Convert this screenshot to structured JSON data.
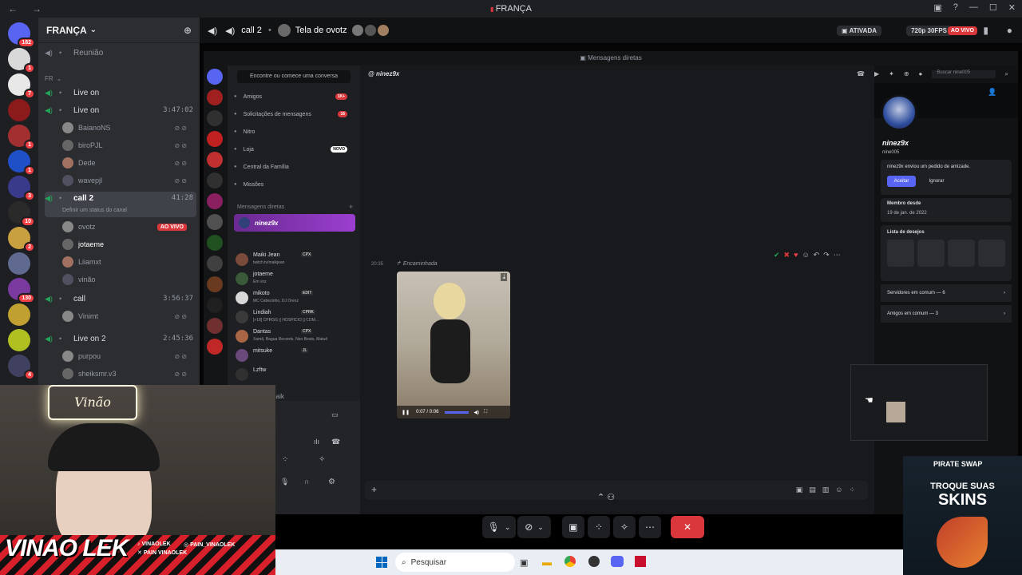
{
  "window": {
    "title": "FRANÇA",
    "nav_back": "←",
    "nav_fwd": "→"
  },
  "guild": {
    "name": "FRANÇA",
    "chevron": "⌄"
  },
  "servers": [
    {
      "badge": "182",
      "color": "#5865f2"
    },
    {
      "badge": "1",
      "color": "#d9d9d9"
    },
    {
      "badge": "7",
      "color": "#e8e8e8"
    },
    {
      "badge": "",
      "color": "#8b1a1a"
    },
    {
      "badge": "1",
      "color": "#a23030"
    },
    {
      "badge": "1",
      "color": "#2050c8"
    },
    {
      "badge": "3",
      "color": "#3a3a8a"
    },
    {
      "badge": "10",
      "color": "#2a2a2a"
    },
    {
      "badge": "2",
      "color": "#c8a040"
    },
    {
      "badge": "",
      "color": "#606a90"
    },
    {
      "badge": "130",
      "color": "#7a3aa0"
    },
    {
      "badge": "",
      "color": "#c0a030"
    },
    {
      "badge": "",
      "color": "#b0c020"
    },
    {
      "badge": "4",
      "color": "#404060"
    }
  ],
  "channels": {
    "reuniao": "Reunião",
    "category": "FR",
    "live_on_1": "Live on",
    "live_on_2": "Live on",
    "live_on_2_time": "3:47:02",
    "users_live_on": [
      "BaianoNS",
      "biroPJL",
      "Dede",
      "wavepjl"
    ],
    "call2": "call 2",
    "call2_time": "41:28",
    "call2_status": "Definir um status do canal",
    "users_call2": [
      "ovotz",
      "jotaeme",
      "Liiamxt",
      "vinão"
    ],
    "ao_vivo": "AO VIVO",
    "call": "call",
    "call_time": "3:56:37",
    "users_call": [
      "Vinimt"
    ],
    "live_on_3": "Live on 2",
    "live_on_3_time": "2:45:36",
    "users_live_on_3": [
      "purpou",
      "sheiksmr.v3"
    ]
  },
  "callbar": {
    "channel": "call 2",
    "screen": "Tela de ovotz",
    "ativada": "ATIVADA",
    "quality": "720p 30FPS",
    "ao_vivo": "AO VIVO"
  },
  "inner": {
    "title": "Mensagens diretas",
    "search_conv": "Encontre ou comece uma conversa",
    "menu": [
      {
        "label": "Amigos",
        "badge": "1K+"
      },
      {
        "label": "Solicitações de mensagens",
        "badge": "16"
      },
      {
        "label": "Nitro",
        "badge": ""
      },
      {
        "label": "Loja",
        "badge": "NOVO"
      },
      {
        "label": "Central da Família",
        "badge": ""
      },
      {
        "label": "Missões",
        "badge": ""
      }
    ],
    "dm_header": "Mensagens diretas",
    "dm_active": "ninez9x",
    "dms": [
      {
        "name": "Maiki Jean",
        "tag": "CPX",
        "sub": "twitch.tv/maikjean"
      },
      {
        "name": "jotaeme",
        "tag": "",
        "sub": "Em voz"
      },
      {
        "name": "mikoto",
        "tag": "EDIT",
        "sub": "MC Cebezinho, DJ Orenz"
      },
      {
        "name": "Lindiah",
        "tag": "CPRK",
        "sub": "[+18] CPRGG || HOSPICIO || COM..."
      },
      {
        "name": "Dantas",
        "tag": "CPX",
        "sub": "Xamã, Bagua Records, Neo Beats, Matuê"
      },
      {
        "name": "mitsuke",
        "tag": "JL",
        "sub": ""
      },
      {
        "name": "Lzftw",
        "tag": "",
        "sub": ""
      }
    ],
    "maik": "maik",
    "chat_title": "ninez9x",
    "forwarded": "Encaminhada",
    "time_label": "20:35",
    "video_time": "0:07 / 0:06",
    "search_placeholder": "Buscar nine005",
    "profile": {
      "name": "ninez9x",
      "handle": "nine005",
      "request": "ninez9x enviou um pedido de amizade.",
      "accept": "Aceitar",
      "ignore": "Ignorar",
      "member_since_label": "Membro desde",
      "member_since": "19 de jan. de 2022",
      "wishlist": "Lista de desejos",
      "servers_common": "Servidores em comum — 6",
      "friends_common": "Amigos em comum — 3"
    }
  },
  "cam": {
    "neon": "Vinão",
    "brand": "VINAO LEK",
    "social1": "VINAOLEK",
    "social2": "PAIN_VINAOLEK",
    "social3": "PAIN VINAOLEK"
  },
  "taskbar": {
    "search": "Pesquisar"
  },
  "ad": {
    "brand": "PIRATE SWAP",
    "line1": "TROQUE SUAS",
    "line2": "SKINS"
  },
  "colors": {
    "green": "#23a55a",
    "red": "#da373c",
    "blurple": "#5865f2",
    "purple_active": "#9b3fd1"
  }
}
